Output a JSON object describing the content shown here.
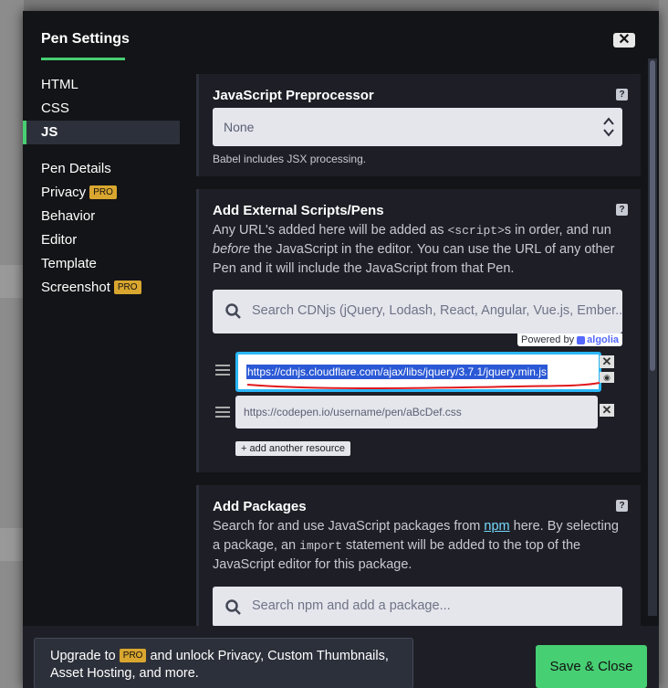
{
  "modal": {
    "title": "Pen Settings",
    "close_label": "✕"
  },
  "sidebar": {
    "items": [
      {
        "label": "HTML"
      },
      {
        "label": "CSS"
      },
      {
        "label": "JS",
        "active": true
      }
    ],
    "settings_items": [
      {
        "label": "Pen Details"
      },
      {
        "label": "Privacy",
        "badge": "PRO"
      },
      {
        "label": "Behavior"
      },
      {
        "label": "Editor"
      },
      {
        "label": "Template"
      },
      {
        "label": "Screenshot",
        "badge": "PRO"
      }
    ]
  },
  "preprocessor": {
    "heading": "JavaScript Preprocessor",
    "selected": "None",
    "help_text": "Babel includes JSX processing.",
    "help_icon": "?"
  },
  "external": {
    "heading": "Add External Scripts/Pens",
    "desc_1": "Any URL's added here will be added as ",
    "desc_code": "<script>",
    "desc_2": "s in order, and run ",
    "desc_em": "before",
    "desc_3": " the JavaScript in the editor. You can use the URL of any other Pen and it will include the JavaScript from that Pen.",
    "search_placeholder": "Search CDNjs (jQuery, Lodash, React, Angular, Vue.js, Ember...",
    "powered_by": "Powered by",
    "algolia": "algolia",
    "resource_1_value": "https://cdnjs.cloudflare.com/ajax/libs/jquery/3.7.1/jquery.min.js",
    "resource_2_placeholder": "https://codepen.io/username/pen/aBcDef.css",
    "add_resource": "+ add another resource",
    "help_icon": "?"
  },
  "packages": {
    "heading": "Add Packages",
    "desc_1": "Search for and use JavaScript packages from ",
    "desc_link": "npm",
    "desc_2": " here. By selecting a package, an ",
    "desc_code": "import",
    "desc_3": " statement will be added to the top of the JavaScript editor for this package.",
    "search_placeholder": "Search npm and add a package...",
    "help_icon": "?"
  },
  "footer": {
    "upgrade_1": "Upgrade to ",
    "upgrade_badge": "PRO",
    "upgrade_2": " and unlock Privacy, Custom Thumbnails, Asset Hosting, and more.",
    "save_label": "Save & Close"
  },
  "colors": {
    "accent": "#47cf73",
    "modal_bg": "#131417",
    "panel_bg": "#1e1f26",
    "focus_border": "#29b6f6",
    "annotation": "#e0191e"
  }
}
